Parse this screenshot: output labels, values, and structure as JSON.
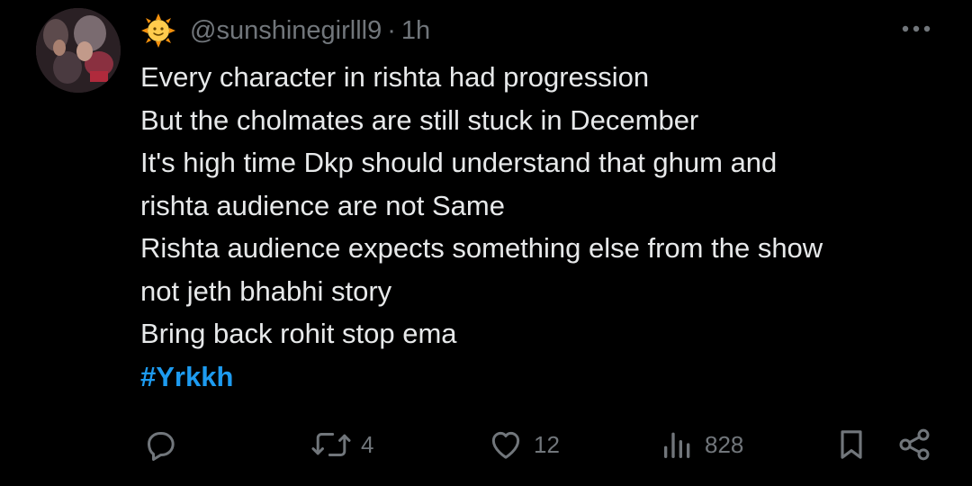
{
  "tweet": {
    "author": {
      "handle": "@sunshinegirlll9",
      "name_emoji": "sun-with-face-icon",
      "avatar": "avatar"
    },
    "separator": "·",
    "time": "1h",
    "lines": [
      "Every character in rishta had progression",
      "But the cholmates are still stuck in December",
      "It's high time Dkp should understand that ghum and",
      "rishta audience are not Same",
      "Rishta audience expects something else from the show",
      "not jeth bhabhi story",
      "Bring back rohit stop ema"
    ],
    "hashtag": "#Yrkkh",
    "actions": {
      "reply": {
        "icon": "reply-icon",
        "count": ""
      },
      "retweet": {
        "icon": "retweet-icon",
        "count": "4"
      },
      "like": {
        "icon": "heart-icon",
        "count": "12"
      },
      "views": {
        "icon": "views-icon",
        "count": "828"
      },
      "bookmark": {
        "icon": "bookmark-icon"
      },
      "share": {
        "icon": "share-icon"
      }
    }
  },
  "colors": {
    "background": "#000000",
    "text": "#e7e9ea",
    "muted": "#71767b",
    "accent": "#1d9bf0"
  }
}
